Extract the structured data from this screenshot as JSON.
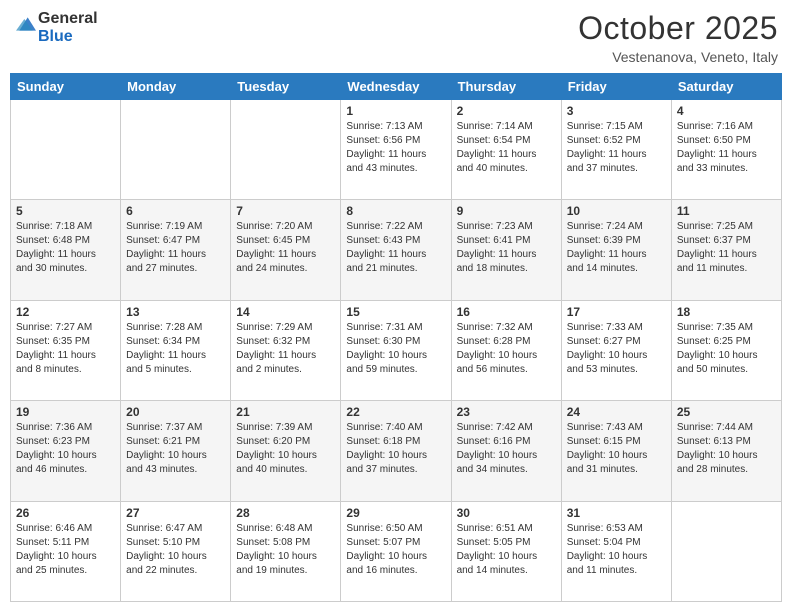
{
  "header": {
    "logo_general": "General",
    "logo_blue": "Blue",
    "month_title": "October 2025",
    "location": "Vestenanova, Veneto, Italy"
  },
  "days_of_week": [
    "Sunday",
    "Monday",
    "Tuesday",
    "Wednesday",
    "Thursday",
    "Friday",
    "Saturday"
  ],
  "weeks": [
    [
      {
        "day": "",
        "info": ""
      },
      {
        "day": "",
        "info": ""
      },
      {
        "day": "",
        "info": ""
      },
      {
        "day": "1",
        "info": "Sunrise: 7:13 AM\nSunset: 6:56 PM\nDaylight: 11 hours and 43 minutes."
      },
      {
        "day": "2",
        "info": "Sunrise: 7:14 AM\nSunset: 6:54 PM\nDaylight: 11 hours and 40 minutes."
      },
      {
        "day": "3",
        "info": "Sunrise: 7:15 AM\nSunset: 6:52 PM\nDaylight: 11 hours and 37 minutes."
      },
      {
        "day": "4",
        "info": "Sunrise: 7:16 AM\nSunset: 6:50 PM\nDaylight: 11 hours and 33 minutes."
      }
    ],
    [
      {
        "day": "5",
        "info": "Sunrise: 7:18 AM\nSunset: 6:48 PM\nDaylight: 11 hours and 30 minutes."
      },
      {
        "day": "6",
        "info": "Sunrise: 7:19 AM\nSunset: 6:47 PM\nDaylight: 11 hours and 27 minutes."
      },
      {
        "day": "7",
        "info": "Sunrise: 7:20 AM\nSunset: 6:45 PM\nDaylight: 11 hours and 24 minutes."
      },
      {
        "day": "8",
        "info": "Sunrise: 7:22 AM\nSunset: 6:43 PM\nDaylight: 11 hours and 21 minutes."
      },
      {
        "day": "9",
        "info": "Sunrise: 7:23 AM\nSunset: 6:41 PM\nDaylight: 11 hours and 18 minutes."
      },
      {
        "day": "10",
        "info": "Sunrise: 7:24 AM\nSunset: 6:39 PM\nDaylight: 11 hours and 14 minutes."
      },
      {
        "day": "11",
        "info": "Sunrise: 7:25 AM\nSunset: 6:37 PM\nDaylight: 11 hours and 11 minutes."
      }
    ],
    [
      {
        "day": "12",
        "info": "Sunrise: 7:27 AM\nSunset: 6:35 PM\nDaylight: 11 hours and 8 minutes."
      },
      {
        "day": "13",
        "info": "Sunrise: 7:28 AM\nSunset: 6:34 PM\nDaylight: 11 hours and 5 minutes."
      },
      {
        "day": "14",
        "info": "Sunrise: 7:29 AM\nSunset: 6:32 PM\nDaylight: 11 hours and 2 minutes."
      },
      {
        "day": "15",
        "info": "Sunrise: 7:31 AM\nSunset: 6:30 PM\nDaylight: 10 hours and 59 minutes."
      },
      {
        "day": "16",
        "info": "Sunrise: 7:32 AM\nSunset: 6:28 PM\nDaylight: 10 hours and 56 minutes."
      },
      {
        "day": "17",
        "info": "Sunrise: 7:33 AM\nSunset: 6:27 PM\nDaylight: 10 hours and 53 minutes."
      },
      {
        "day": "18",
        "info": "Sunrise: 7:35 AM\nSunset: 6:25 PM\nDaylight: 10 hours and 50 minutes."
      }
    ],
    [
      {
        "day": "19",
        "info": "Sunrise: 7:36 AM\nSunset: 6:23 PM\nDaylight: 10 hours and 46 minutes."
      },
      {
        "day": "20",
        "info": "Sunrise: 7:37 AM\nSunset: 6:21 PM\nDaylight: 10 hours and 43 minutes."
      },
      {
        "day": "21",
        "info": "Sunrise: 7:39 AM\nSunset: 6:20 PM\nDaylight: 10 hours and 40 minutes."
      },
      {
        "day": "22",
        "info": "Sunrise: 7:40 AM\nSunset: 6:18 PM\nDaylight: 10 hours and 37 minutes."
      },
      {
        "day": "23",
        "info": "Sunrise: 7:42 AM\nSunset: 6:16 PM\nDaylight: 10 hours and 34 minutes."
      },
      {
        "day": "24",
        "info": "Sunrise: 7:43 AM\nSunset: 6:15 PM\nDaylight: 10 hours and 31 minutes."
      },
      {
        "day": "25",
        "info": "Sunrise: 7:44 AM\nSunset: 6:13 PM\nDaylight: 10 hours and 28 minutes."
      }
    ],
    [
      {
        "day": "26",
        "info": "Sunrise: 6:46 AM\nSunset: 5:11 PM\nDaylight: 10 hours and 25 minutes."
      },
      {
        "day": "27",
        "info": "Sunrise: 6:47 AM\nSunset: 5:10 PM\nDaylight: 10 hours and 22 minutes."
      },
      {
        "day": "28",
        "info": "Sunrise: 6:48 AM\nSunset: 5:08 PM\nDaylight: 10 hours and 19 minutes."
      },
      {
        "day": "29",
        "info": "Sunrise: 6:50 AM\nSunset: 5:07 PM\nDaylight: 10 hours and 16 minutes."
      },
      {
        "day": "30",
        "info": "Sunrise: 6:51 AM\nSunset: 5:05 PM\nDaylight: 10 hours and 14 minutes."
      },
      {
        "day": "31",
        "info": "Sunrise: 6:53 AM\nSunset: 5:04 PM\nDaylight: 10 hours and 11 minutes."
      },
      {
        "day": "",
        "info": ""
      }
    ]
  ]
}
